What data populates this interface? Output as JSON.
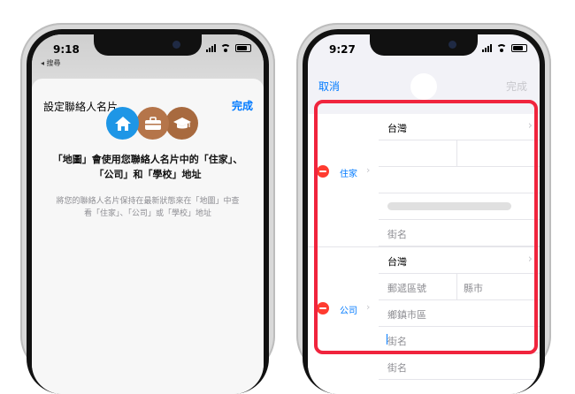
{
  "left_phone": {
    "time": "9:18",
    "back_app": "◂ 搜尋",
    "sheet_title": "設定聯絡人名片",
    "done_label": "完成",
    "icons": [
      "home-icon",
      "briefcase-icon",
      "graduation-cap-icon"
    ],
    "headline_line1": "「地圖」會使用您聯絡人名片中的「住家」、",
    "headline_line2": "「公司」和「學校」地址",
    "sub_line1": "將您的聯絡人名片保持在最新狀態來在「地圖」中查",
    "sub_line2": "看「住家」、「公司」或「學校」地址"
  },
  "right_phone": {
    "time": "9:27",
    "cancel_label": "取消",
    "done_label": "完成",
    "home_section": {
      "label": "住家",
      "country": "台灣",
      "street_placeholder": "街名"
    },
    "work_section": {
      "label": "公司",
      "country": "台灣",
      "postal_placeholder": "郵遞區號",
      "county_placeholder": "縣市",
      "district_placeholder": "鄉鎮市區",
      "street_placeholder": "街名",
      "street2_placeholder": "街名"
    }
  },
  "colors": {
    "accent": "#007aff",
    "highlight_border": "#f0243d",
    "delete_red": "#ff3b30",
    "home_icon_bg": "#1e96e6",
    "work_icon_bg": "#b5754a"
  }
}
